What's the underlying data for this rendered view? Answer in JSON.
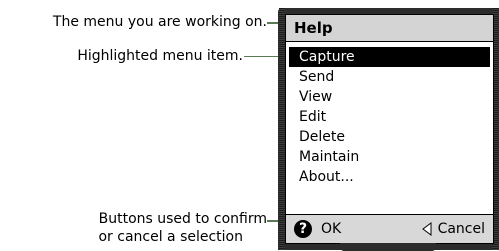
{
  "callouts": {
    "menu": "The menu you are working on.",
    "highlight": "Highlighted menu item.",
    "buttons_line1": "Buttons used to confirm",
    "buttons_line2": "or cancel a selection"
  },
  "screen": {
    "title": "Help",
    "menu_items": [
      "Capture",
      "Send",
      "View",
      "Edit",
      "Delete",
      "Maintain",
      "About..."
    ],
    "selected_index": 0,
    "ok_icon_glyph": "?",
    "ok_label": "OK",
    "cancel_label": "Cancel"
  },
  "colors": {
    "bezel": "#2c2c2c",
    "title_bar": "#d4d4d4",
    "highlight": "#000000",
    "leader_line": "#5a7a55"
  },
  "icons": [
    "help-question-icon",
    "back-triangle-icon"
  ]
}
